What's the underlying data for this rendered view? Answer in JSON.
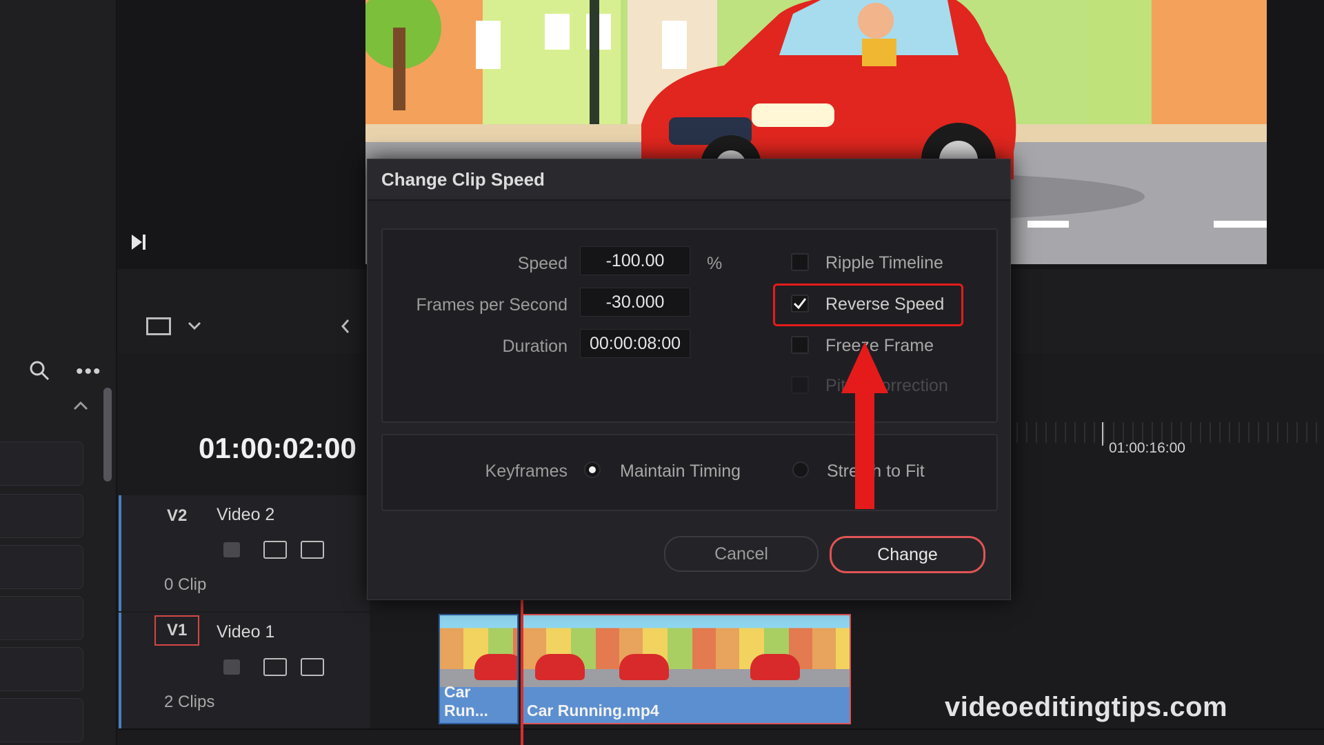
{
  "viewer": {
    "timecode": "01:00:02:00"
  },
  "dialog": {
    "title": "Change Clip Speed",
    "speed": {
      "label": "Speed",
      "value": "-100.00",
      "unit": "%"
    },
    "fps": {
      "label": "Frames per Second",
      "value": "-30.000"
    },
    "duration": {
      "label": "Duration",
      "value": "00:00:08:00"
    },
    "options": {
      "ripple_timeline": {
        "label": "Ripple Timeline",
        "checked": false
      },
      "reverse_speed": {
        "label": "Reverse Speed",
        "checked": true
      },
      "freeze_frame": {
        "label": "Freeze Frame",
        "checked": false
      },
      "pitch_correction": {
        "label": "Pitch Correction",
        "checked": false,
        "disabled": true
      }
    },
    "keyframes": {
      "label": "Keyframes",
      "maintain_timing": "Maintain Timing",
      "stretch_to_fit": "Stretch to Fit",
      "selected": "maintain_timing"
    },
    "cancel_label": "Cancel",
    "change_label": "Change"
  },
  "timeline": {
    "ruler_time": "01:00:16:00",
    "tracks": [
      {
        "id": "V2",
        "name": "Video 2",
        "count": "0 Clip"
      },
      {
        "id": "V1",
        "name": "Video 1",
        "count": "2 Clips"
      }
    ],
    "clips": [
      {
        "label": "Car Run..."
      },
      {
        "label": "Car Running.mp4"
      }
    ]
  },
  "watermark": "videoeditingtips.com",
  "colors": {
    "highlight_red": "#e51b1b",
    "clip_blue": "#5c8fd0",
    "dialog_bg": "#242428"
  }
}
